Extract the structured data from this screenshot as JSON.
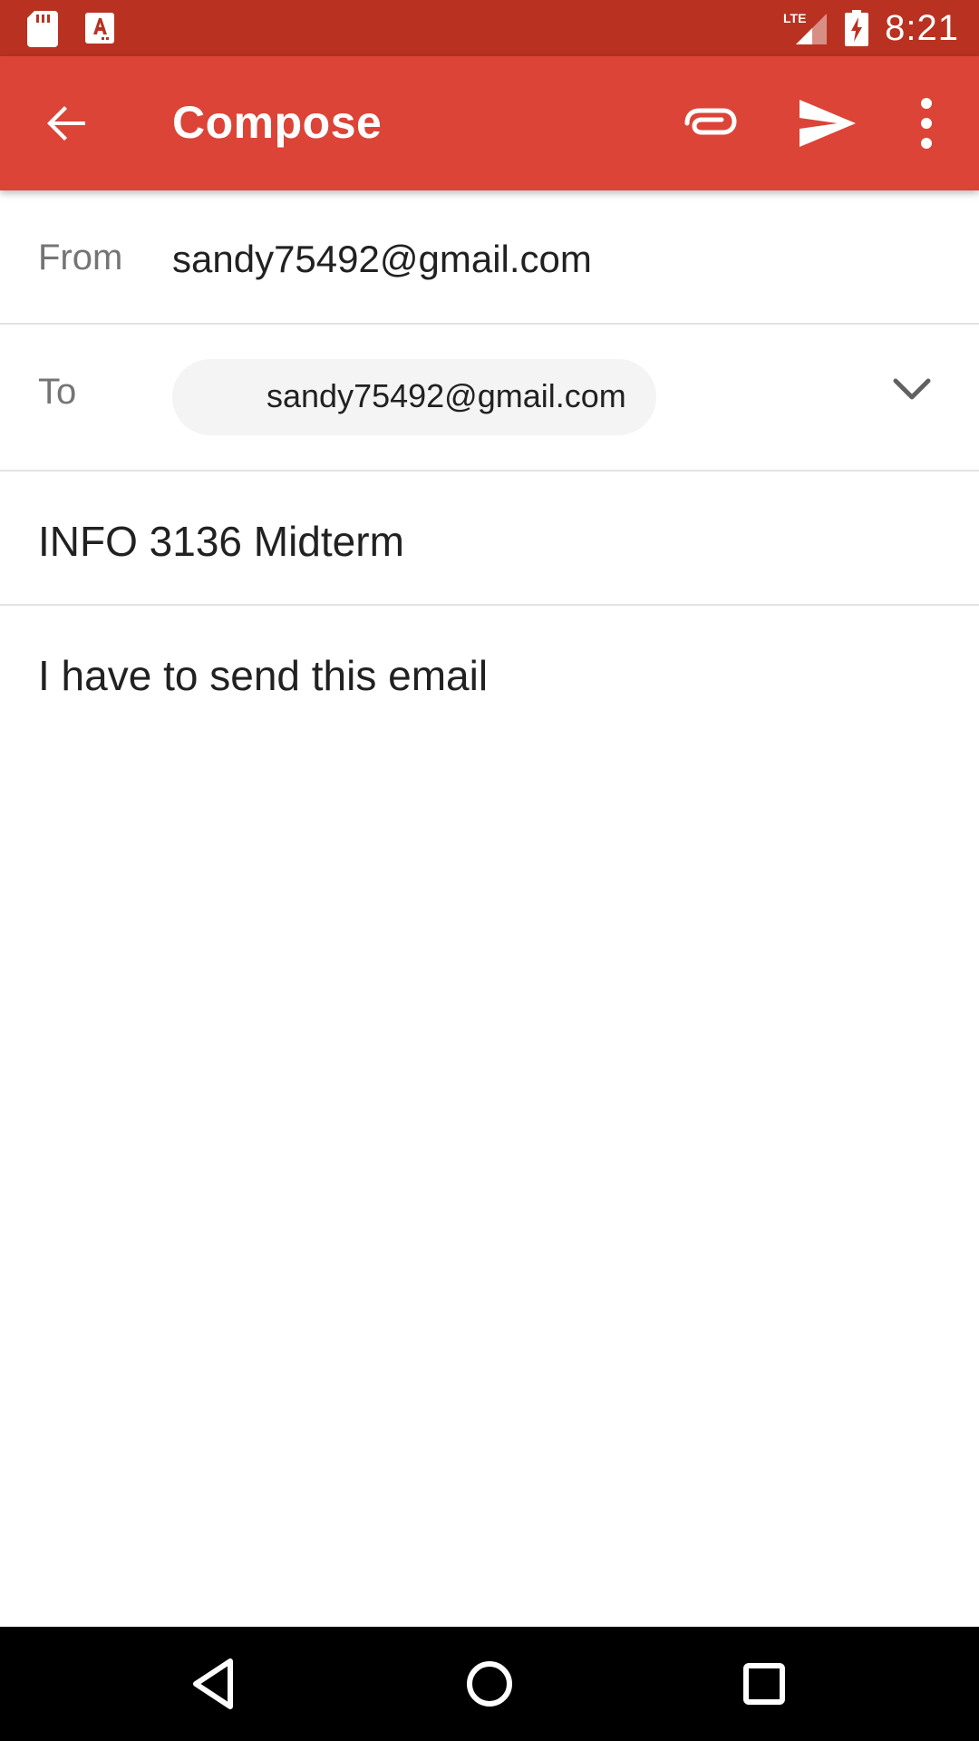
{
  "status_bar": {
    "time": "8:21",
    "network": "LTE",
    "icons": [
      "sd-card-icon",
      "font-app-icon",
      "lte-signal-icon",
      "battery-charging-icon"
    ]
  },
  "app_bar": {
    "title": "Compose",
    "icons": [
      "back-arrow-icon",
      "paperclip-icon",
      "send-icon",
      "more-vert-icon"
    ],
    "color": "#db4437",
    "status_color": "#b93221"
  },
  "compose": {
    "from_label": "From",
    "from_value": "sandy75492@gmail.com",
    "to_label": "To",
    "to_chip": "sandy75492@gmail.com",
    "subject": "INFO 3136 Midterm",
    "body": "I have to send this email"
  },
  "nav_bar": {
    "icons": [
      "nav-back-icon",
      "nav-home-icon",
      "nav-recents-icon"
    ]
  }
}
